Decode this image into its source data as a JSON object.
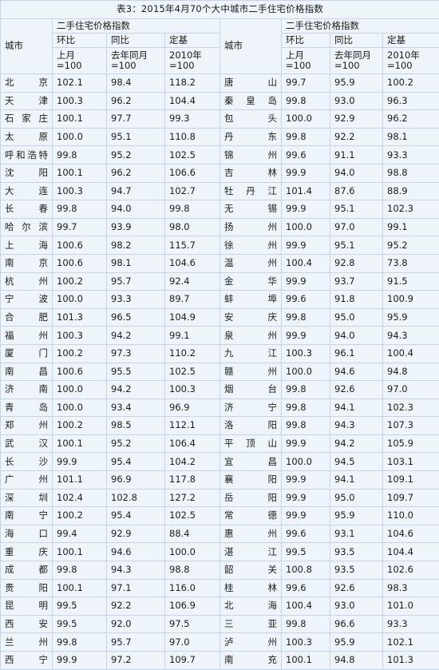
{
  "title": "表3：2015年4月70个大中城市二手住宅价格指数",
  "header": {
    "city_label": "城市",
    "group_label": "二手住宅价格指数",
    "columns": [
      {
        "name": "环比",
        "basis_line1": "上月",
        "basis_line2": "=100"
      },
      {
        "name": "同比",
        "basis_line1": "去年同月",
        "basis_line2": "=100"
      },
      {
        "name": "定基",
        "basis_line1": "2010年",
        "basis_line2": "=100"
      }
    ]
  },
  "colors": {
    "cell_background": "#eff4fa",
    "border": "#c3d4e8",
    "text": "#1b1b1b",
    "page_background": "#ffffff"
  },
  "rows": [
    {
      "left": {
        "city": "北京",
        "mom": "102.1",
        "yoy": "98.4",
        "base": "118.2"
      },
      "right": {
        "city": "唐山",
        "mom": "99.7",
        "yoy": "95.9",
        "base": "100.2"
      }
    },
    {
      "left": {
        "city": "天津",
        "mom": "100.3",
        "yoy": "96.2",
        "base": "104.4"
      },
      "right": {
        "city": "秦皇岛",
        "mom": "99.8",
        "yoy": "93.0",
        "base": "96.3"
      }
    },
    {
      "left": {
        "city": "石家庄",
        "mom": "100.1",
        "yoy": "97.7",
        "base": "99.3"
      },
      "right": {
        "city": "包头",
        "mom": "100.0",
        "yoy": "92.9",
        "base": "96.2"
      }
    },
    {
      "left": {
        "city": "太原",
        "mom": "100.0",
        "yoy": "95.1",
        "base": "110.8"
      },
      "right": {
        "city": "丹东",
        "mom": "99.8",
        "yoy": "92.2",
        "base": "98.1"
      }
    },
    {
      "left": {
        "city": "呼和浩特",
        "mom": "99.8",
        "yoy": "95.2",
        "base": "102.5"
      },
      "right": {
        "city": "锦州",
        "mom": "99.6",
        "yoy": "91.1",
        "base": "93.3"
      }
    },
    {
      "left": {
        "city": "沈阳",
        "mom": "100.1",
        "yoy": "96.2",
        "base": "106.6"
      },
      "right": {
        "city": "吉林",
        "mom": "99.9",
        "yoy": "94.0",
        "base": "98.8"
      }
    },
    {
      "left": {
        "city": "大连",
        "mom": "100.3",
        "yoy": "94.7",
        "base": "102.7"
      },
      "right": {
        "city": "牡丹江",
        "mom": "101.4",
        "yoy": "87.6",
        "base": "88.9"
      }
    },
    {
      "left": {
        "city": "长春",
        "mom": "99.8",
        "yoy": "94.0",
        "base": "99.8"
      },
      "right": {
        "city": "无锡",
        "mom": "99.9",
        "yoy": "95.1",
        "base": "102.3"
      }
    },
    {
      "left": {
        "city": "哈尔滨",
        "mom": "99.7",
        "yoy": "93.9",
        "base": "98.0"
      },
      "right": {
        "city": "扬州",
        "mom": "100.0",
        "yoy": "97.0",
        "base": "99.1"
      }
    },
    {
      "left": {
        "city": "上海",
        "mom": "100.6",
        "yoy": "98.2",
        "base": "115.7"
      },
      "right": {
        "city": "徐州",
        "mom": "99.9",
        "yoy": "95.1",
        "base": "95.2"
      }
    },
    {
      "left": {
        "city": "南京",
        "mom": "100.6",
        "yoy": "98.1",
        "base": "104.6"
      },
      "right": {
        "city": "温州",
        "mom": "100.4",
        "yoy": "92.8",
        "base": "73.8"
      }
    },
    {
      "left": {
        "city": "杭州",
        "mom": "100.2",
        "yoy": "95.7",
        "base": "92.4"
      },
      "right": {
        "city": "金华",
        "mom": "99.9",
        "yoy": "93.7",
        "base": "91.5"
      }
    },
    {
      "left": {
        "city": "宁波",
        "mom": "100.0",
        "yoy": "93.3",
        "base": "89.7"
      },
      "right": {
        "city": "蚌埠",
        "mom": "99.6",
        "yoy": "91.8",
        "base": "100.9"
      }
    },
    {
      "left": {
        "city": "合肥",
        "mom": "101.3",
        "yoy": "96.5",
        "base": "104.9"
      },
      "right": {
        "city": "安庆",
        "mom": "99.8",
        "yoy": "95.0",
        "base": "95.9"
      }
    },
    {
      "left": {
        "city": "福州",
        "mom": "100.3",
        "yoy": "94.2",
        "base": "99.1"
      },
      "right": {
        "city": "泉州",
        "mom": "99.9",
        "yoy": "94.0",
        "base": "94.3"
      }
    },
    {
      "left": {
        "city": "厦门",
        "mom": "100.2",
        "yoy": "97.3",
        "base": "110.2"
      },
      "right": {
        "city": "九江",
        "mom": "100.3",
        "yoy": "96.1",
        "base": "100.4"
      }
    },
    {
      "left": {
        "city": "南昌",
        "mom": "100.6",
        "yoy": "95.5",
        "base": "102.5"
      },
      "right": {
        "city": "赣州",
        "mom": "100.0",
        "yoy": "94.6",
        "base": "94.8"
      }
    },
    {
      "left": {
        "city": "济南",
        "mom": "100.0",
        "yoy": "94.2",
        "base": "100.3"
      },
      "right": {
        "city": "烟台",
        "mom": "99.8",
        "yoy": "92.6",
        "base": "97.0"
      }
    },
    {
      "left": {
        "city": "青岛",
        "mom": "100.0",
        "yoy": "93.4",
        "base": "96.9"
      },
      "right": {
        "city": "济宁",
        "mom": "99.8",
        "yoy": "94.1",
        "base": "102.3"
      }
    },
    {
      "left": {
        "city": "郑州",
        "mom": "100.2",
        "yoy": "98.5",
        "base": "112.1"
      },
      "right": {
        "city": "洛阳",
        "mom": "99.8",
        "yoy": "94.3",
        "base": "107.3"
      }
    },
    {
      "left": {
        "city": "武汉",
        "mom": "100.1",
        "yoy": "95.2",
        "base": "106.4"
      },
      "right": {
        "city": "平顶山",
        "mom": "99.9",
        "yoy": "94.2",
        "base": "105.9"
      }
    },
    {
      "left": {
        "city": "长沙",
        "mom": "99.9",
        "yoy": "95.4",
        "base": "104.2"
      },
      "right": {
        "city": "宜昌",
        "mom": "100.0",
        "yoy": "94.5",
        "base": "103.1"
      }
    },
    {
      "left": {
        "city": "广州",
        "mom": "101.1",
        "yoy": "96.9",
        "base": "117.8"
      },
      "right": {
        "city": "襄阳",
        "mom": "99.9",
        "yoy": "94.1",
        "base": "109.1"
      }
    },
    {
      "left": {
        "city": "深圳",
        "mom": "102.4",
        "yoy": "102.8",
        "base": "127.2"
      },
      "right": {
        "city": "岳阳",
        "mom": "99.9",
        "yoy": "95.0",
        "base": "109.7"
      }
    },
    {
      "left": {
        "city": "南宁",
        "mom": "100.2",
        "yoy": "95.4",
        "base": "102.5"
      },
      "right": {
        "city": "常德",
        "mom": "99.9",
        "yoy": "95.9",
        "base": "110.0"
      }
    },
    {
      "left": {
        "city": "海口",
        "mom": "99.4",
        "yoy": "92.9",
        "base": "88.4"
      },
      "right": {
        "city": "惠州",
        "mom": "99.6",
        "yoy": "93.1",
        "base": "104.6"
      }
    },
    {
      "left": {
        "city": "重庆",
        "mom": "100.1",
        "yoy": "94.6",
        "base": "100.0"
      },
      "right": {
        "city": "湛江",
        "mom": "99.5",
        "yoy": "93.5",
        "base": "104.4"
      }
    },
    {
      "left": {
        "city": "成都",
        "mom": "99.8",
        "yoy": "94.3",
        "base": "98.8"
      },
      "right": {
        "city": "韶关",
        "mom": "100.8",
        "yoy": "93.5",
        "base": "102.6"
      }
    },
    {
      "left": {
        "city": "贵阳",
        "mom": "100.1",
        "yoy": "97.1",
        "base": "116.0"
      },
      "right": {
        "city": "桂林",
        "mom": "99.6",
        "yoy": "92.6",
        "base": "98.3"
      }
    },
    {
      "left": {
        "city": "昆明",
        "mom": "99.5",
        "yoy": "92.2",
        "base": "106.9"
      },
      "right": {
        "city": "北海",
        "mom": "100.4",
        "yoy": "93.0",
        "base": "101.0"
      }
    },
    {
      "left": {
        "city": "西安",
        "mom": "99.5",
        "yoy": "92.0",
        "base": "97.5"
      },
      "right": {
        "city": "三亚",
        "mom": "99.8",
        "yoy": "96.6",
        "base": "93.3"
      }
    },
    {
      "left": {
        "city": "兰州",
        "mom": "99.8",
        "yoy": "95.7",
        "base": "97.0"
      },
      "right": {
        "city": "泸州",
        "mom": "100.3",
        "yoy": "95.9",
        "base": "102.1"
      }
    },
    {
      "left": {
        "city": "西宁",
        "mom": "99.9",
        "yoy": "97.2",
        "base": "109.7"
      },
      "right": {
        "city": "南充",
        "mom": "100.1",
        "yoy": "94.8",
        "base": "101.3"
      }
    }
  ]
}
